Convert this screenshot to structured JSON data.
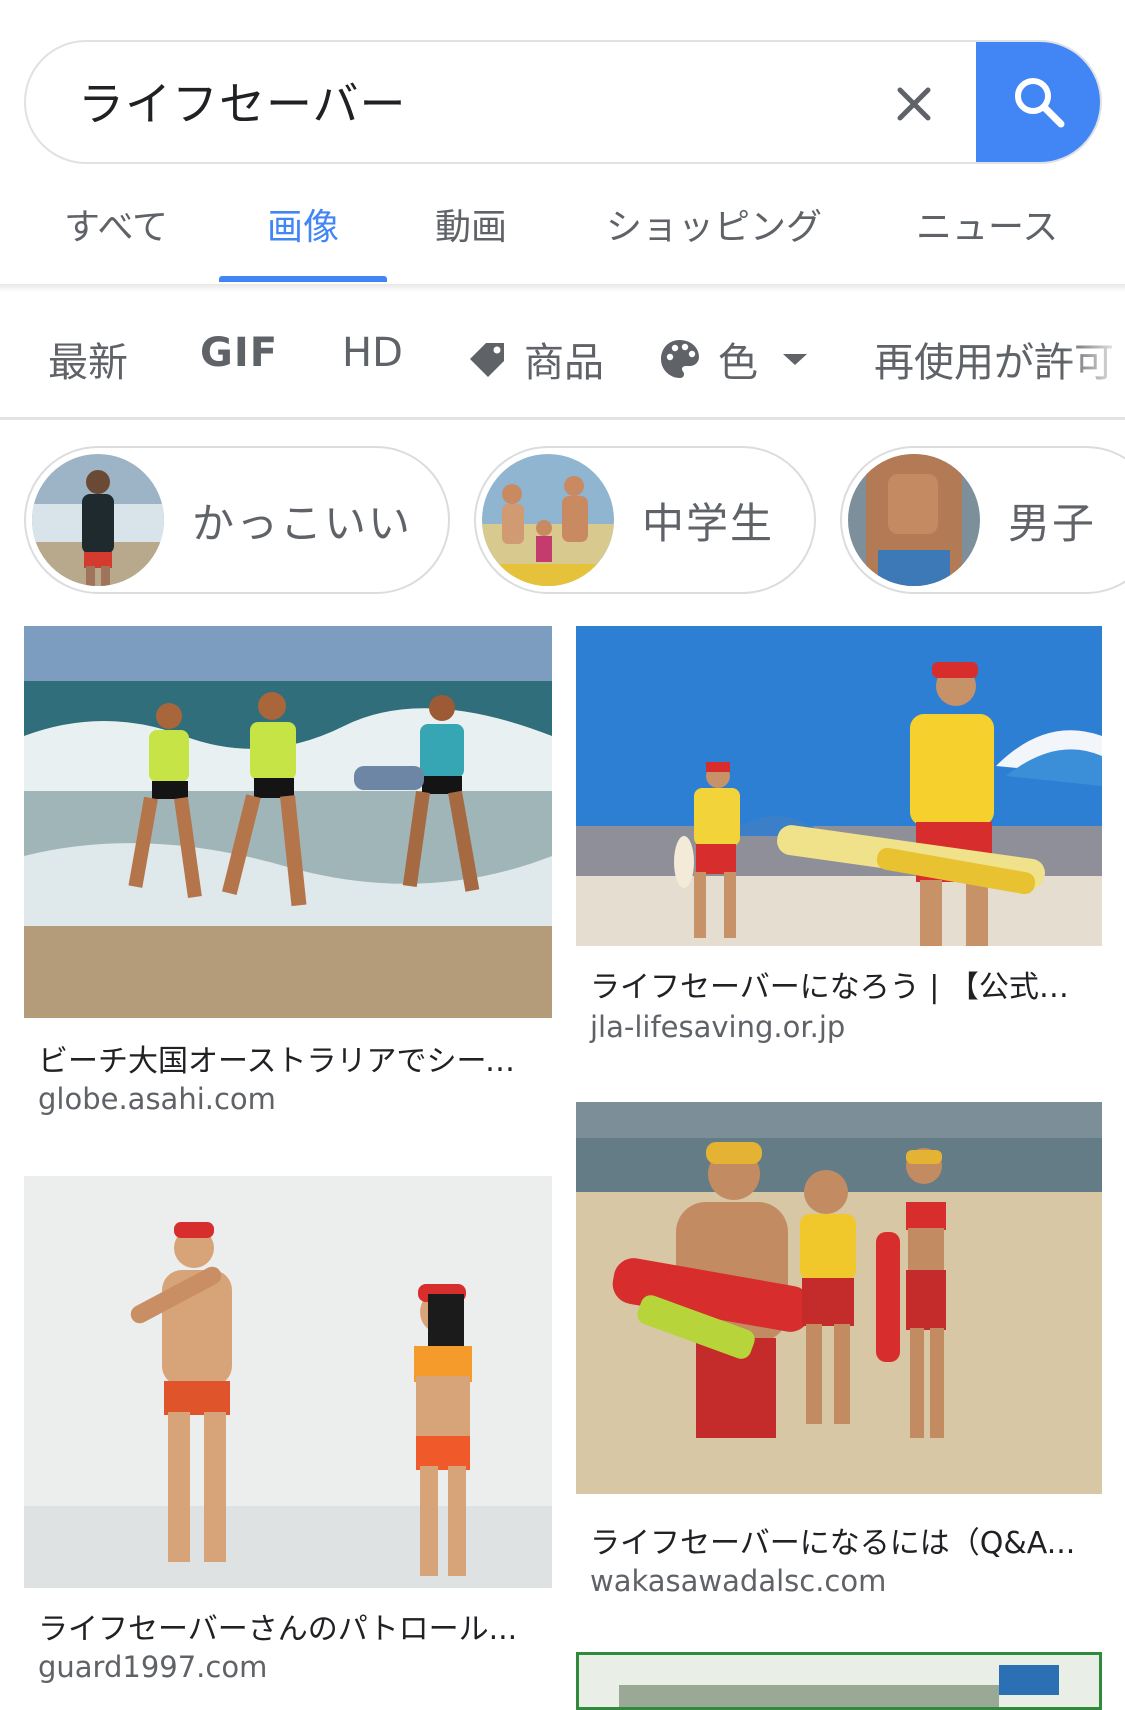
{
  "search": {
    "query": "ライフセーバー",
    "clear_icon": "close-icon",
    "search_icon": "search-icon",
    "accent": "#4285f4"
  },
  "tabs": [
    {
      "label": "すべて",
      "active": false
    },
    {
      "label": "画像",
      "active": true
    },
    {
      "label": "動画",
      "active": false
    },
    {
      "label": "ショッピング",
      "active": false
    },
    {
      "label": "ニュース",
      "active": false
    }
  ],
  "filters": {
    "latest": "最新",
    "gif": "GIF",
    "hd": "HD",
    "products": "商品",
    "color": "色",
    "reuse": "再使用が許可"
  },
  "related": [
    {
      "label": "かっこいい"
    },
    {
      "label": "中学生"
    },
    {
      "label": "男子"
    }
  ],
  "results": [
    {
      "title": "ビーチ大国オーストラリアでシーズ...",
      "domain": "globe.asahi.com"
    },
    {
      "title": "ライフセーバーになろう | 【公式】...",
      "domain": "jla-lifesaving.or.jp"
    },
    {
      "title": "ライフセーバーさんのパトロール...",
      "domain": "guard1997.com"
    },
    {
      "title": "ライフセーバーになるには（Q&A...",
      "domain": "wakasawadalsc.com"
    }
  ]
}
